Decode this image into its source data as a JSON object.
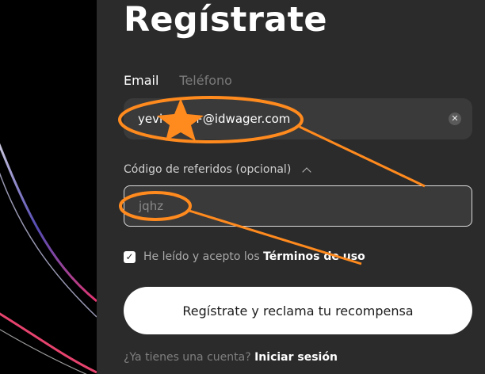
{
  "page": {
    "title": "Regístrate"
  },
  "tabs": [
    {
      "label": "Email",
      "active": true
    },
    {
      "label": "Teléfono",
      "active": false
    }
  ],
  "email_field": {
    "value": "yevi        +@idwager.com",
    "clear_icon": "close-icon"
  },
  "referral": {
    "label": "Código de referidos (opcional)",
    "value": "jqhz",
    "toggle_icon": "chevron-up-icon"
  },
  "terms": {
    "checked": true,
    "text": "He leído y acepto los",
    "link": "Términos de uso"
  },
  "submit": {
    "label": "Regístrate y reclama tu recompensa"
  },
  "login": {
    "prompt": "¿Ya tienes una cuenta?",
    "link": "Iniciar sesión"
  },
  "colors": {
    "panel": "#2b2b2b",
    "input": "#3a3a3a",
    "annotation": "#ff8a1e"
  }
}
